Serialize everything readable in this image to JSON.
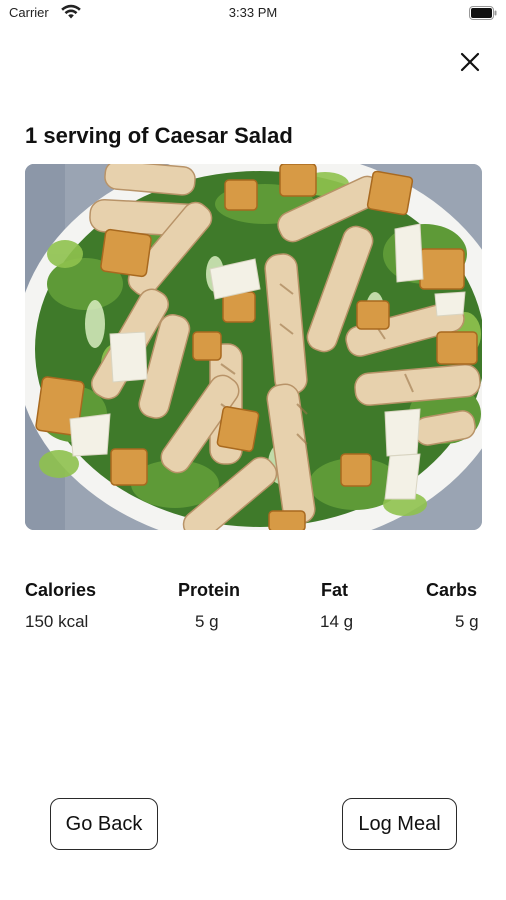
{
  "status_bar": {
    "carrier": "Carrier",
    "time": "3:33 PM",
    "wifi_icon": "wifi-icon",
    "battery_icon": "battery-icon"
  },
  "close_icon": "close-icon",
  "title": "1 serving of Caesar Salad",
  "image": {
    "subject": "salad-photo"
  },
  "nutrition": [
    {
      "label": "Calories",
      "value": "150 kcal"
    },
    {
      "label": "Protein",
      "value": "5 g"
    },
    {
      "label": "Fat",
      "value": "14 g"
    },
    {
      "label": "Carbs",
      "value": "5 g"
    }
  ],
  "buttons": {
    "go_back": "Go Back",
    "log_meal": "Log Meal"
  },
  "colors": {
    "text": "#111111",
    "background": "#ffffff",
    "button_border": "#2a2a2a"
  }
}
